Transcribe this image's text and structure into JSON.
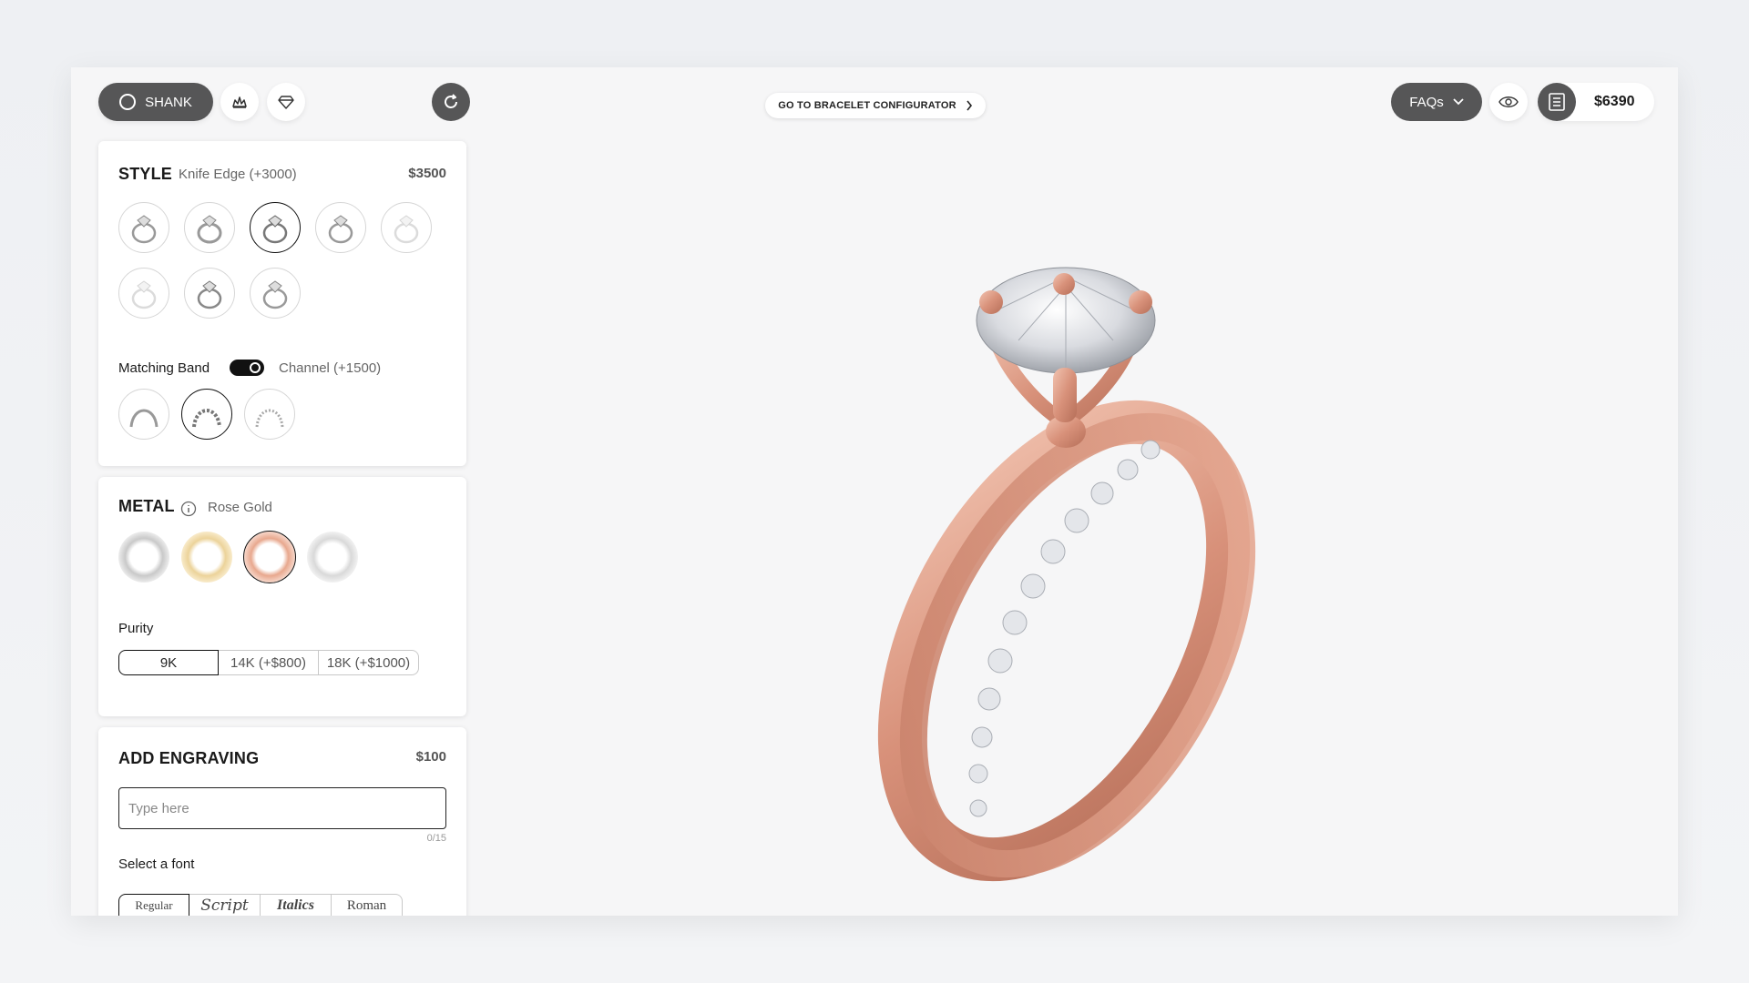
{
  "topbar": {
    "shank_tab": "SHANK",
    "bracelet_link": "GO TO BRACELET CONFIGURATOR",
    "faq_label": "FAQs",
    "total_price": "$6390"
  },
  "style_panel": {
    "title": "STYLE",
    "selected": "Knife Edge (+3000)",
    "price": "$3500",
    "matching_band_label": "Matching Band",
    "matching_band_value": "Channel (+1500)",
    "matching_band_on": true
  },
  "metal_panel": {
    "title": "METAL",
    "selected": "Rose Gold",
    "swatch_colors": [
      "#c9c9c9",
      "#ecd39a",
      "#e8a88e",
      "#d9d9d9"
    ],
    "purity_label": "Purity",
    "purity_options": [
      "9K",
      "14K (+$800)",
      "18K (+$1000)"
    ],
    "purity_selected": "9K"
  },
  "engraving_panel": {
    "title": "ADD ENGRAVING",
    "price": "$100",
    "placeholder": "Type here",
    "counter": "0/15",
    "font_label": "Select a font",
    "fonts": [
      "Regular",
      "Script",
      "Italics",
      "Roman"
    ]
  },
  "icons": {
    "head_tab": "crown-icon",
    "stone_tab": "diamond-icon",
    "reset": "refresh-icon",
    "preview": "eye-icon",
    "summary": "list-icon"
  }
}
